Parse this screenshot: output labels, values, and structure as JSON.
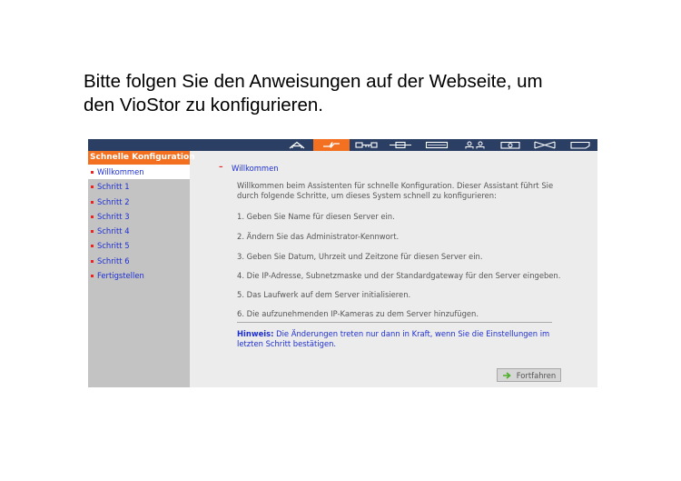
{
  "slide": {
    "line1": "Bitte folgen Sie den Anweisungen auf der Webseite, um",
    "line2": "den VioStor zu konfigurieren."
  },
  "topbar": {
    "tabs": [
      {
        "icon": "home-icon",
        "active": false
      },
      {
        "icon": "quick-config-icon",
        "active": true
      },
      {
        "icon": "system-settings-icon",
        "active": false
      },
      {
        "icon": "network-icon",
        "active": false
      },
      {
        "icon": "disk-icon",
        "active": false
      },
      {
        "icon": "users-icon",
        "active": false
      },
      {
        "icon": "camera-icon",
        "active": false
      },
      {
        "icon": "recording-icon",
        "active": false
      },
      {
        "icon": "logs-icon",
        "active": false
      }
    ],
    "colors": {
      "bar": "#2a3f63",
      "active": "#f37021"
    }
  },
  "sidebar": {
    "header": "Schnelle Konfiguration",
    "items": [
      {
        "label": "Willkommen",
        "current": true
      },
      {
        "label": "Schritt 1"
      },
      {
        "label": "Schritt 2"
      },
      {
        "label": "Schritt 3"
      },
      {
        "label": "Schritt 4"
      },
      {
        "label": "Schritt 5"
      },
      {
        "label": "Schritt 6"
      },
      {
        "label": "Fertigstellen"
      }
    ]
  },
  "main": {
    "dash": "–",
    "title": "Willkommen",
    "intro": "Willkommen beim Assistenten für schnelle Konfiguration. Dieser Assistant führt Sie durch folgende Schritte, um dieses System schnell zu konfigurieren:",
    "steps": [
      "1. Geben Sie Name für diesen Server ein.",
      "2. Ändern Sie das Administrator-Kennwort.",
      "3. Geben Sie Datum, Uhrzeit und Zeitzone für diesen Server ein.",
      "4. Die IP-Adresse, Subnetzmaske und der Standardgateway für den Server eingeben.",
      "5. Das Laufwerk auf dem Server initialisieren.",
      "6. Die aufzunehmenden IP-Kameras zu dem Server hinzufügen."
    ],
    "note_label": "Hinweis:",
    "note_text": "Die Änderungen treten nur dann in Kraft, wenn Sie die Einstellungen im letzten Schritt bestätigen."
  },
  "button": {
    "label": "Fortfahren",
    "icon": "arrow-right-icon",
    "icon_color": "#4caf27"
  }
}
